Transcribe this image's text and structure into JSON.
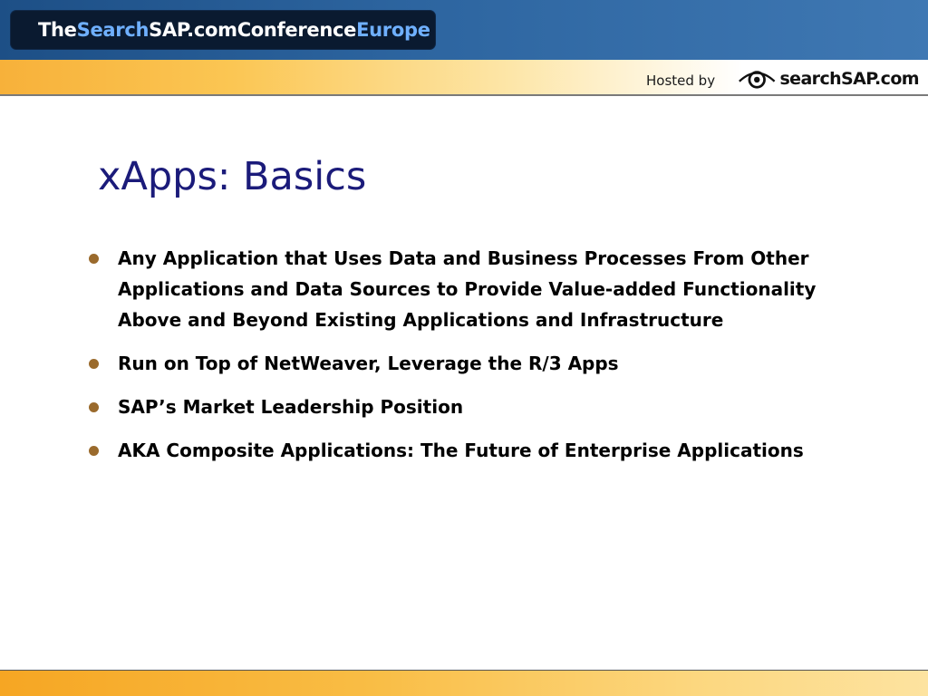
{
  "header": {
    "conference_title_parts": {
      "the": "The ",
      "search": "Search",
      "sap": "SAP.com",
      "conference": " Conference ",
      "europe": "Europe"
    },
    "hosted_by": "Hosted by",
    "logo_text": "searchSAP.com"
  },
  "slide": {
    "title": "xApps: Basics",
    "bullets": [
      "Any Application that Uses Data and Business Processes From Other Applications and Data Sources to Provide Value-added Functionality Above and Beyond Existing Applications and Infrastructure",
      "Run on Top of NetWeaver, Leverage the R/3 Apps",
      "SAP’s Market Leadership Position",
      "AKA Composite Applications: The Future of Enterprise Applications"
    ]
  },
  "colors": {
    "banner_blue": "#2d65a0",
    "pill_dark": "#0a1a30",
    "pill_accent_blue": "#6fb0ff",
    "title_navy": "#1b1b7a",
    "bullet_brown": "#9a6a2c",
    "orange": "#f7b13a"
  },
  "icons": {
    "logo_mark": "eye-icon"
  }
}
